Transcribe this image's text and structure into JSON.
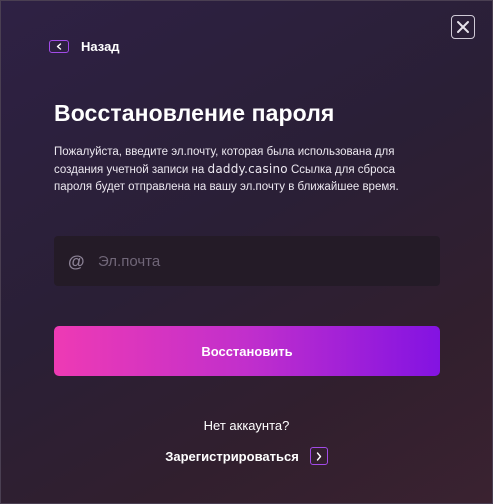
{
  "header": {
    "back_label": "Назад",
    "close_icon": "close-icon",
    "back_icon": "chevron-left-icon"
  },
  "main": {
    "title": "Восстановление пароля",
    "description_before_brand": "Пожалуйста, введите эл.почту, которая была использована для создания учетной записи на ",
    "brand": "daddy.casino",
    "description_after_brand": " Ссылка для сброса пароля будет отправлена на вашу эл.почту в ближайшее время.",
    "email": {
      "value": "",
      "placeholder": "Эл.почта",
      "icon": "at-icon",
      "icon_glyph": "@"
    },
    "submit_label": "Восстановить"
  },
  "footer": {
    "no_account": "Нет аккаунта?",
    "register_label": "Зарегистрироваться",
    "register_icon": "chevron-right-icon"
  },
  "colors": {
    "accent": "#a24be8",
    "button_gradient_start": "#ee3ab4",
    "button_gradient_end": "#8313e2",
    "field_background": "#241b27"
  }
}
